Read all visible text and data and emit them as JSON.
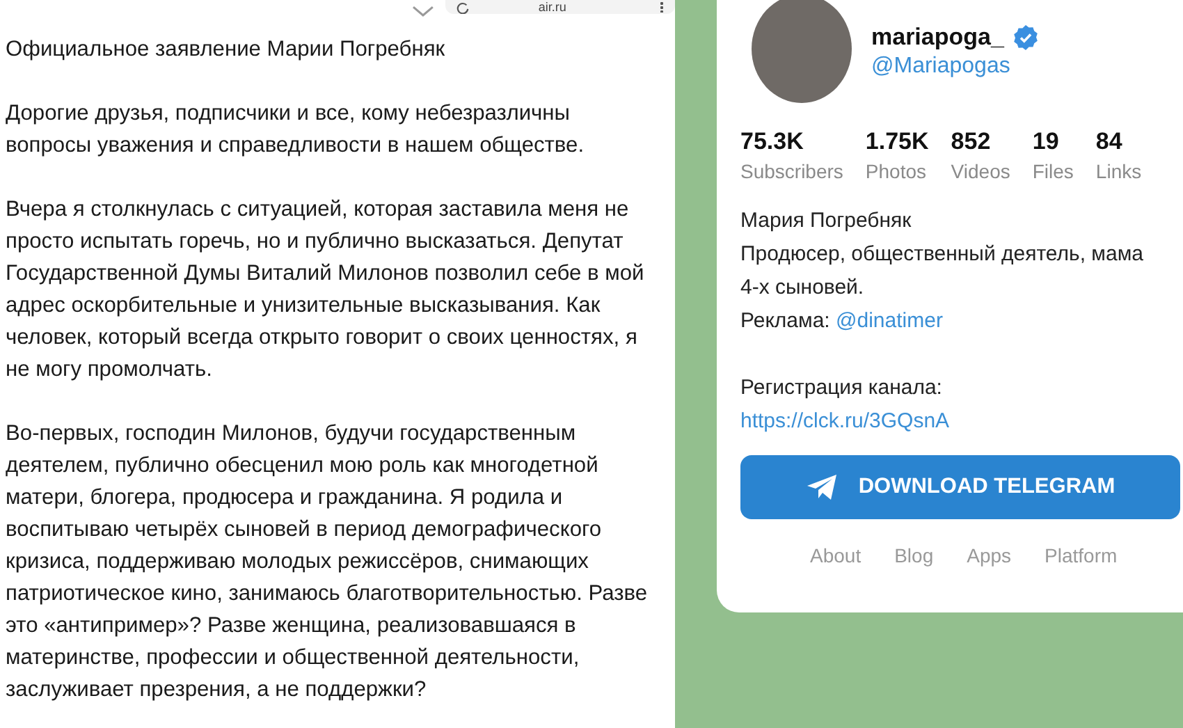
{
  "browser_bar": {
    "address": "air.ru"
  },
  "article": {
    "title": "Официальное заявление Марии Погребняк",
    "paragraphs": [
      "Дорогие друзья, подписчики и все, кому небезразличны вопросы уважения и справедливости в нашем обществе.",
      "Вчера я столкнулась с ситуацией, которая заставила меня не просто испытать горечь, но и публично высказаться. Депутат Государственной Думы Виталий Милонов позволил себе в мой адрес оскорбительные и унизительные высказывания. Как человек, который всегда открыто говорит о своих ценностях, я не могу промолчать.",
      "Во-первых, господин Милонов, будучи государственным деятелем, публично обесценил мою роль как многодетной матери, блогера, продюсера и гражданина. Я родила и воспитываю четырёх сыновей в период демографического кризиса, поддерживаю молодых режиссёров, снимающих патриотическое кино, занимаюсь благотворительностью. Разве это «антипример»? Разве женщина, реализовавшаяся в материнстве, профессии и общественной деятельности, заслуживает презрения, а не поддержки?"
    ]
  },
  "profile": {
    "name": "mariapoga_",
    "verified": true,
    "handle": "@Mariapogas",
    "stats": [
      {
        "value": "75.3K",
        "label": "Subscribers"
      },
      {
        "value": "1.75K",
        "label": "Photos"
      },
      {
        "value": "852",
        "label": "Videos"
      },
      {
        "value": "19",
        "label": "Files"
      },
      {
        "value": "84",
        "label": "Links"
      }
    ],
    "bio": [
      {
        "kind": "text",
        "text": "Мария Погребняк"
      },
      {
        "kind": "text",
        "text": "Продюсер, общественный деятель, мама 4-х сыновей."
      },
      {
        "kind": "mixed",
        "text": "Реклама: ",
        "link": "@dinatimer"
      },
      {
        "kind": "gap"
      },
      {
        "kind": "text",
        "text": "Регистрация канала:"
      },
      {
        "kind": "link",
        "link": "https://clck.ru/3GQsnA"
      }
    ],
    "button": "DOWNLOAD TELEGRAM",
    "footer_links": [
      "About",
      "Blog",
      "Apps",
      "Platform"
    ]
  }
}
